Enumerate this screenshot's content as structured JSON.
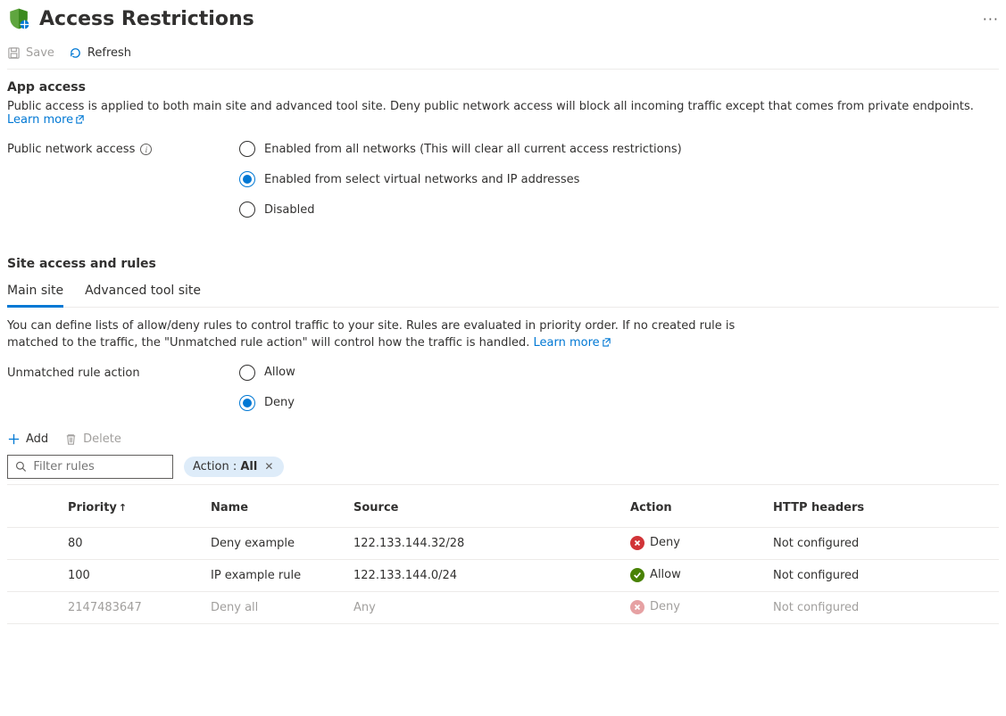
{
  "header": {
    "title": "Access Restrictions"
  },
  "toolbar": {
    "save": "Save",
    "refresh": "Refresh"
  },
  "app_access": {
    "title": "App access",
    "desc": "Public access is applied to both main site and advanced tool site. Deny public network access will block all incoming traffic except that comes from private endpoints.",
    "learn_more": "Learn more",
    "label": "Public network access",
    "options": {
      "all": "Enabled from all networks (This will clear all current access restrictions)",
      "select": "Enabled from select virtual networks and IP addresses",
      "disabled": "Disabled"
    }
  },
  "site_access": {
    "title": "Site access and rules",
    "tabs": {
      "main": "Main site",
      "advanced": "Advanced tool site"
    },
    "desc": "You can define lists of allow/deny rules to control traffic to your site. Rules are evaluated in priority order. If no created rule is matched to the traffic, the \"Unmatched rule action\" will control how the traffic is handled.",
    "learn_more": "Learn more",
    "unmatched_label": "Unmatched rule action",
    "unmatched_options": {
      "allow": "Allow",
      "deny": "Deny"
    }
  },
  "rule_actions": {
    "add": "Add",
    "delete": "Delete"
  },
  "filter": {
    "placeholder": "Filter rules",
    "chip_label": "Action : ",
    "chip_value": "All"
  },
  "table": {
    "headers": {
      "priority": "Priority",
      "name": "Name",
      "source": "Source",
      "action": "Action",
      "http": "HTTP headers"
    },
    "rows": [
      {
        "priority": "80",
        "name": "Deny example",
        "source": "122.133.144.32/28",
        "action": "Deny",
        "http": "Not configured",
        "action_kind": "deny"
      },
      {
        "priority": "100",
        "name": "IP example rule",
        "source": "122.133.144.0/24",
        "action": "Allow",
        "http": "Not configured",
        "action_kind": "allow"
      },
      {
        "priority": "2147483647",
        "name": "Deny all",
        "source": "Any",
        "action": "Deny",
        "http": "Not configured",
        "action_kind": "deny",
        "muted": true
      }
    ]
  }
}
